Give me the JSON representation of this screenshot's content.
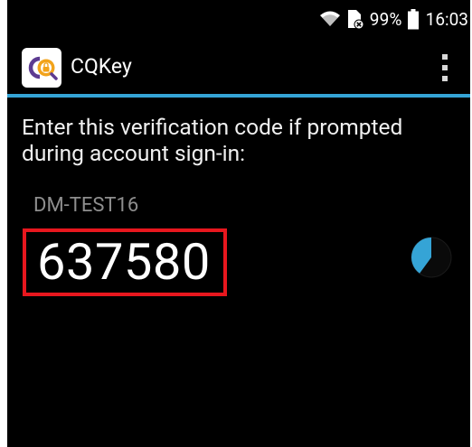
{
  "status_bar": {
    "battery_percent": "99%",
    "time": "16:03",
    "icons": [
      "wifi-icon",
      "no-sim-icon",
      "battery-icon"
    ]
  },
  "app_bar": {
    "title": "CQKey",
    "logo_icon": "cqkey-logo-icon",
    "menu_icon": "overflow-menu-icon",
    "accent_color": "#35a4d6"
  },
  "content": {
    "instructions": "Enter this verification code if prompted during account sign-in:",
    "account_name": "DM-TEST16",
    "verification_code": "637580",
    "highlight_color": "#e8171e",
    "timer": {
      "icon": "countdown-timer-icon",
      "remaining_fraction": 0.4,
      "color": "#35a4d6"
    }
  }
}
